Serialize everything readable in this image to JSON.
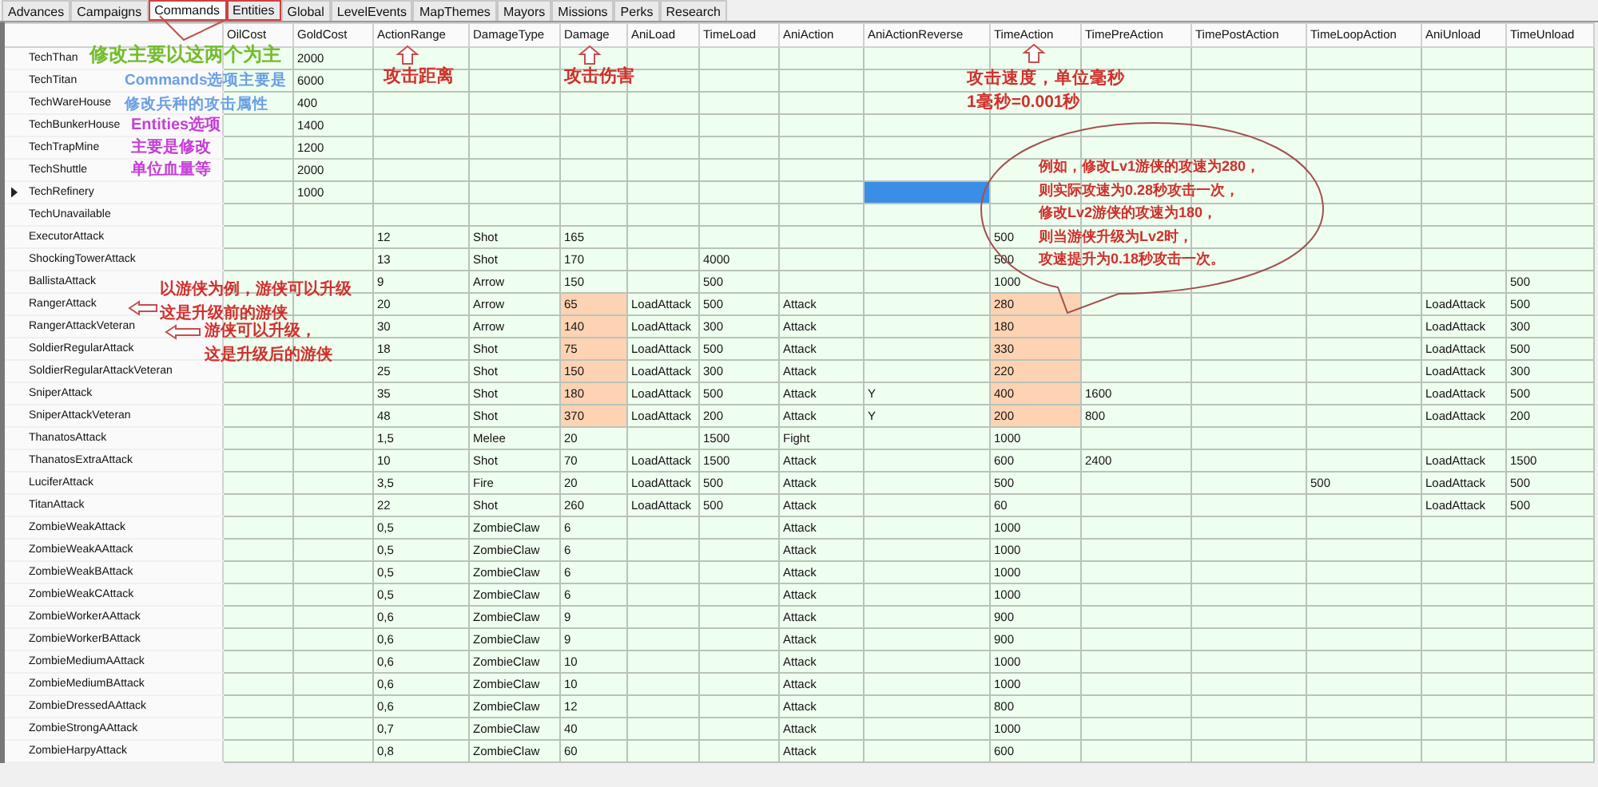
{
  "tabs": [
    {
      "label": "Advances",
      "selected": false,
      "marked": false
    },
    {
      "label": "Campaigns",
      "selected": false,
      "marked": false
    },
    {
      "label": "Commands",
      "selected": true,
      "marked": true
    },
    {
      "label": "Entities",
      "selected": false,
      "marked": true
    },
    {
      "label": "Global",
      "selected": false,
      "marked": false
    },
    {
      "label": "LevelEvents",
      "selected": false,
      "marked": false
    },
    {
      "label": "MapThemes",
      "selected": false,
      "marked": false
    },
    {
      "label": "Mayors",
      "selected": false,
      "marked": false
    },
    {
      "label": "Missions",
      "selected": false,
      "marked": false
    },
    {
      "label": "Perks",
      "selected": false,
      "marked": false
    },
    {
      "label": "Research",
      "selected": false,
      "marked": false
    }
  ],
  "grid": {
    "columns": [
      "OilCost",
      "GoldCost",
      "ActionRange",
      "DamageType",
      "Damage",
      "AniLoad",
      "TimeLoad",
      "AniAction",
      "AniActionReverse",
      "TimeAction",
      "TimePreAction",
      "TimePostAction",
      "TimeLoopAction",
      "AniUnload",
      "TimeUnload"
    ],
    "rows": [
      {
        "name": "TechThan",
        "current": false,
        "cells": {
          "GoldCost": "2000"
        }
      },
      {
        "name": "TechTitan",
        "current": false,
        "cells": {
          "GoldCost": "6000"
        }
      },
      {
        "name": "TechWareHouse",
        "current": false,
        "cells": {
          "GoldCost": "400"
        }
      },
      {
        "name": "TechBunkerHouse",
        "current": false,
        "cells": {
          "GoldCost": "1400"
        }
      },
      {
        "name": "TechTrapMine",
        "current": false,
        "cells": {
          "GoldCost": "1200"
        }
      },
      {
        "name": "TechShuttle",
        "current": false,
        "cells": {
          "GoldCost": "2000"
        }
      },
      {
        "name": "TechRefinery",
        "current": true,
        "cells": {
          "GoldCost": "1000",
          "AniActionReverse": {
            "selected": true
          }
        }
      },
      {
        "name": "TechUnavailable",
        "current": false,
        "cells": {}
      },
      {
        "name": "ExecutorAttack",
        "current": false,
        "cells": {
          "ActionRange": "12",
          "DamageType": "Shot",
          "Damage": "165",
          "TimeAction": "500"
        }
      },
      {
        "name": "ShockingTowerAttack",
        "current": false,
        "cells": {
          "ActionRange": "13",
          "DamageType": "Shot",
          "Damage": "170",
          "TimeLoad": "4000",
          "TimeAction": "500"
        }
      },
      {
        "name": "BallistaAttack",
        "current": false,
        "cells": {
          "ActionRange": "9",
          "DamageType": "Arrow",
          "Damage": "150",
          "TimeLoad": "500",
          "TimeAction": "1000",
          "TimeUnload": "500"
        }
      },
      {
        "name": "RangerAttack",
        "current": false,
        "cells": {
          "ActionRange": "20",
          "DamageType": "Arrow",
          "Damage": {
            "text": "65",
            "highlighted": true
          },
          "AniLoad": "LoadAttack",
          "TimeLoad": "500",
          "AniAction": "Attack",
          "TimeAction": {
            "text": "280",
            "highlighted": true
          },
          "AniUnload": "LoadAttack",
          "TimeUnload": "500"
        }
      },
      {
        "name": "RangerAttackVeteran",
        "current": false,
        "cells": {
          "ActionRange": "30",
          "DamageType": "Arrow",
          "Damage": {
            "text": "140",
            "highlighted": true
          },
          "AniLoad": "LoadAttack",
          "TimeLoad": "300",
          "AniAction": "Attack",
          "TimeAction": {
            "text": "180",
            "highlighted": true
          },
          "AniUnload": "LoadAttack",
          "TimeUnload": "300"
        }
      },
      {
        "name": "SoldierRegularAttack",
        "current": false,
        "cells": {
          "ActionRange": "18",
          "DamageType": "Shot",
          "Damage": {
            "text": "75",
            "highlighted": true
          },
          "AniLoad": "LoadAttack",
          "TimeLoad": "500",
          "AniAction": "Attack",
          "TimeAction": {
            "text": "330",
            "highlighted": true
          },
          "AniUnload": "LoadAttack",
          "TimeUnload": "500"
        }
      },
      {
        "name": "SoldierRegularAttackVeteran",
        "current": false,
        "cells": {
          "ActionRange": "25",
          "DamageType": "Shot",
          "Damage": {
            "text": "150",
            "highlighted": true
          },
          "AniLoad": "LoadAttack",
          "TimeLoad": "300",
          "AniAction": "Attack",
          "TimeAction": {
            "text": "220",
            "highlighted": true
          },
          "AniUnload": "LoadAttack",
          "TimeUnload": "300"
        }
      },
      {
        "name": "SniperAttack",
        "current": false,
        "cells": {
          "ActionRange": "35",
          "DamageType": "Shot",
          "Damage": {
            "text": "180",
            "highlighted": true
          },
          "AniLoad": "LoadAttack",
          "TimeLoad": "500",
          "AniAction": "Attack",
          "AniActionReverse": "Y",
          "TimeAction": {
            "text": "400",
            "highlighted": true
          },
          "TimePreAction": "1600",
          "AniUnload": "LoadAttack",
          "TimeUnload": "500"
        }
      },
      {
        "name": "SniperAttackVeteran",
        "current": false,
        "cells": {
          "ActionRange": "48",
          "DamageType": "Shot",
          "Damage": {
            "text": "370",
            "highlighted": true
          },
          "AniLoad": "LoadAttack",
          "TimeLoad": "200",
          "AniAction": "Attack",
          "AniActionReverse": "Y",
          "TimeAction": {
            "text": "200",
            "highlighted": true
          },
          "TimePreAction": "800",
          "AniUnload": "LoadAttack",
          "TimeUnload": "200"
        }
      },
      {
        "name": "ThanatosAttack",
        "current": false,
        "cells": {
          "ActionRange": "1,5",
          "DamageType": "Melee",
          "Damage": "20",
          "TimeLoad": "1500",
          "AniAction": "Fight",
          "TimeAction": "1000"
        }
      },
      {
        "name": "ThanatosExtraAttack",
        "current": false,
        "cells": {
          "ActionRange": "10",
          "DamageType": "Shot",
          "Damage": "70",
          "AniLoad": "LoadAttack",
          "TimeLoad": "1500",
          "AniAction": "Attack",
          "TimeAction": "600",
          "TimePreAction": "2400",
          "AniUnload": "LoadAttack",
          "TimeUnload": "1500"
        }
      },
      {
        "name": "LuciferAttack",
        "current": false,
        "cells": {
          "ActionRange": "3,5",
          "DamageType": "Fire",
          "Damage": "20",
          "AniLoad": "LoadAttack",
          "TimeLoad": "500",
          "AniAction": "Attack",
          "TimeAction": "500",
          "TimeLoopAction": "500",
          "AniUnload": "LoadAttack",
          "TimeUnload": "500"
        }
      },
      {
        "name": "TitanAttack",
        "current": false,
        "cells": {
          "ActionRange": "22",
          "DamageType": "Shot",
          "Damage": "260",
          "AniLoad": "LoadAttack",
          "TimeLoad": "500",
          "AniAction": "Attack",
          "TimeAction": "60",
          "AniUnload": "LoadAttack",
          "TimeUnload": "500"
        }
      },
      {
        "name": "ZombieWeakAttack",
        "current": false,
        "cells": {
          "ActionRange": "0,5",
          "DamageType": "ZombieClaw",
          "Damage": "6",
          "AniAction": "Attack",
          "TimeAction": "1000"
        }
      },
      {
        "name": "ZombieWeakAAttack",
        "current": false,
        "cells": {
          "ActionRange": "0,5",
          "DamageType": "ZombieClaw",
          "Damage": "6",
          "AniAction": "Attack",
          "TimeAction": "1000"
        }
      },
      {
        "name": "ZombieWeakBAttack",
        "current": false,
        "cells": {
          "ActionRange": "0,5",
          "DamageType": "ZombieClaw",
          "Damage": "6",
          "AniAction": "Attack",
          "TimeAction": "1000"
        }
      },
      {
        "name": "ZombieWeakCAttack",
        "current": false,
        "cells": {
          "ActionRange": "0,5",
          "DamageType": "ZombieClaw",
          "Damage": "6",
          "AniAction": "Attack",
          "TimeAction": "1000"
        }
      },
      {
        "name": "ZombieWorkerAAttack",
        "current": false,
        "cells": {
          "ActionRange": "0,6",
          "DamageType": "ZombieClaw",
          "Damage": "9",
          "AniAction": "Attack",
          "TimeAction": "900"
        }
      },
      {
        "name": "ZombieWorkerBAttack",
        "current": false,
        "cells": {
          "ActionRange": "0,6",
          "DamageType": "ZombieClaw",
          "Damage": "9",
          "AniAction": "Attack",
          "TimeAction": "900"
        }
      },
      {
        "name": "ZombieMediumAAttack",
        "current": false,
        "cells": {
          "ActionRange": "0,6",
          "DamageType": "ZombieClaw",
          "Damage": "10",
          "AniAction": "Attack",
          "TimeAction": "1000"
        }
      },
      {
        "name": "ZombieMediumBAttack",
        "current": false,
        "cells": {
          "ActionRange": "0,6",
          "DamageType": "ZombieClaw",
          "Damage": "10",
          "AniAction": "Attack",
          "TimeAction": "1000"
        }
      },
      {
        "name": "ZombieDressedAAttack",
        "current": false,
        "cells": {
          "ActionRange": "0,6",
          "DamageType": "ZombieClaw",
          "Damage": "12",
          "AniAction": "Attack",
          "TimeAction": "800"
        }
      },
      {
        "name": "ZombieStrongAAttack",
        "current": false,
        "cells": {
          "ActionRange": "0,7",
          "DamageType": "ZombieClaw",
          "Damage": "40",
          "AniAction": "Attack",
          "TimeAction": "1000"
        }
      },
      {
        "name": "ZombieHarpyAttack",
        "current": false,
        "cells": {
          "ActionRange": "0,8",
          "DamageType": "ZombieClaw",
          "Damage": "60",
          "AniAction": "Attack",
          "TimeAction": "600"
        }
      }
    ]
  },
  "annotations": [
    {
      "color": "#74bc2f",
      "lines": [
        "修改主要以这两个为主"
      ]
    },
    {
      "color": "#6a9fe6",
      "lines": [
        "Commands选项主要是",
        "修改兵种的攻击属性"
      ]
    },
    {
      "color": "#c43fd6",
      "lines": [
        "Entities选项",
        "主要是修改",
        "单位血量等"
      ]
    },
    {
      "color": "#d0312d",
      "lines": [
        "攻击距离"
      ]
    },
    {
      "color": "#d0312d",
      "lines": [
        "攻击伤害"
      ]
    },
    {
      "color": "#d0312d",
      "lines": [
        "攻击速度，单位毫秒",
        "1毫秒=0.001秒"
      ]
    },
    {
      "color": "#d0312d",
      "lines": [
        "例如，修改Lv1游侠的攻速为280，",
        "则实际攻速为0.28秒攻击一次，",
        "修改Lv2游侠的攻速为180，",
        "则当游侠升级为Lv2时，",
        "攻速提升为0.18秒攻击一次。"
      ]
    },
    {
      "color": "#d0312d",
      "lines": [
        "以游侠为例，游侠可以升级",
        "这是升级前的游侠"
      ]
    },
    {
      "color": "#d0312d",
      "lines": [
        "游侠可以升级，",
        "这是升级后的游侠"
      ]
    }
  ]
}
